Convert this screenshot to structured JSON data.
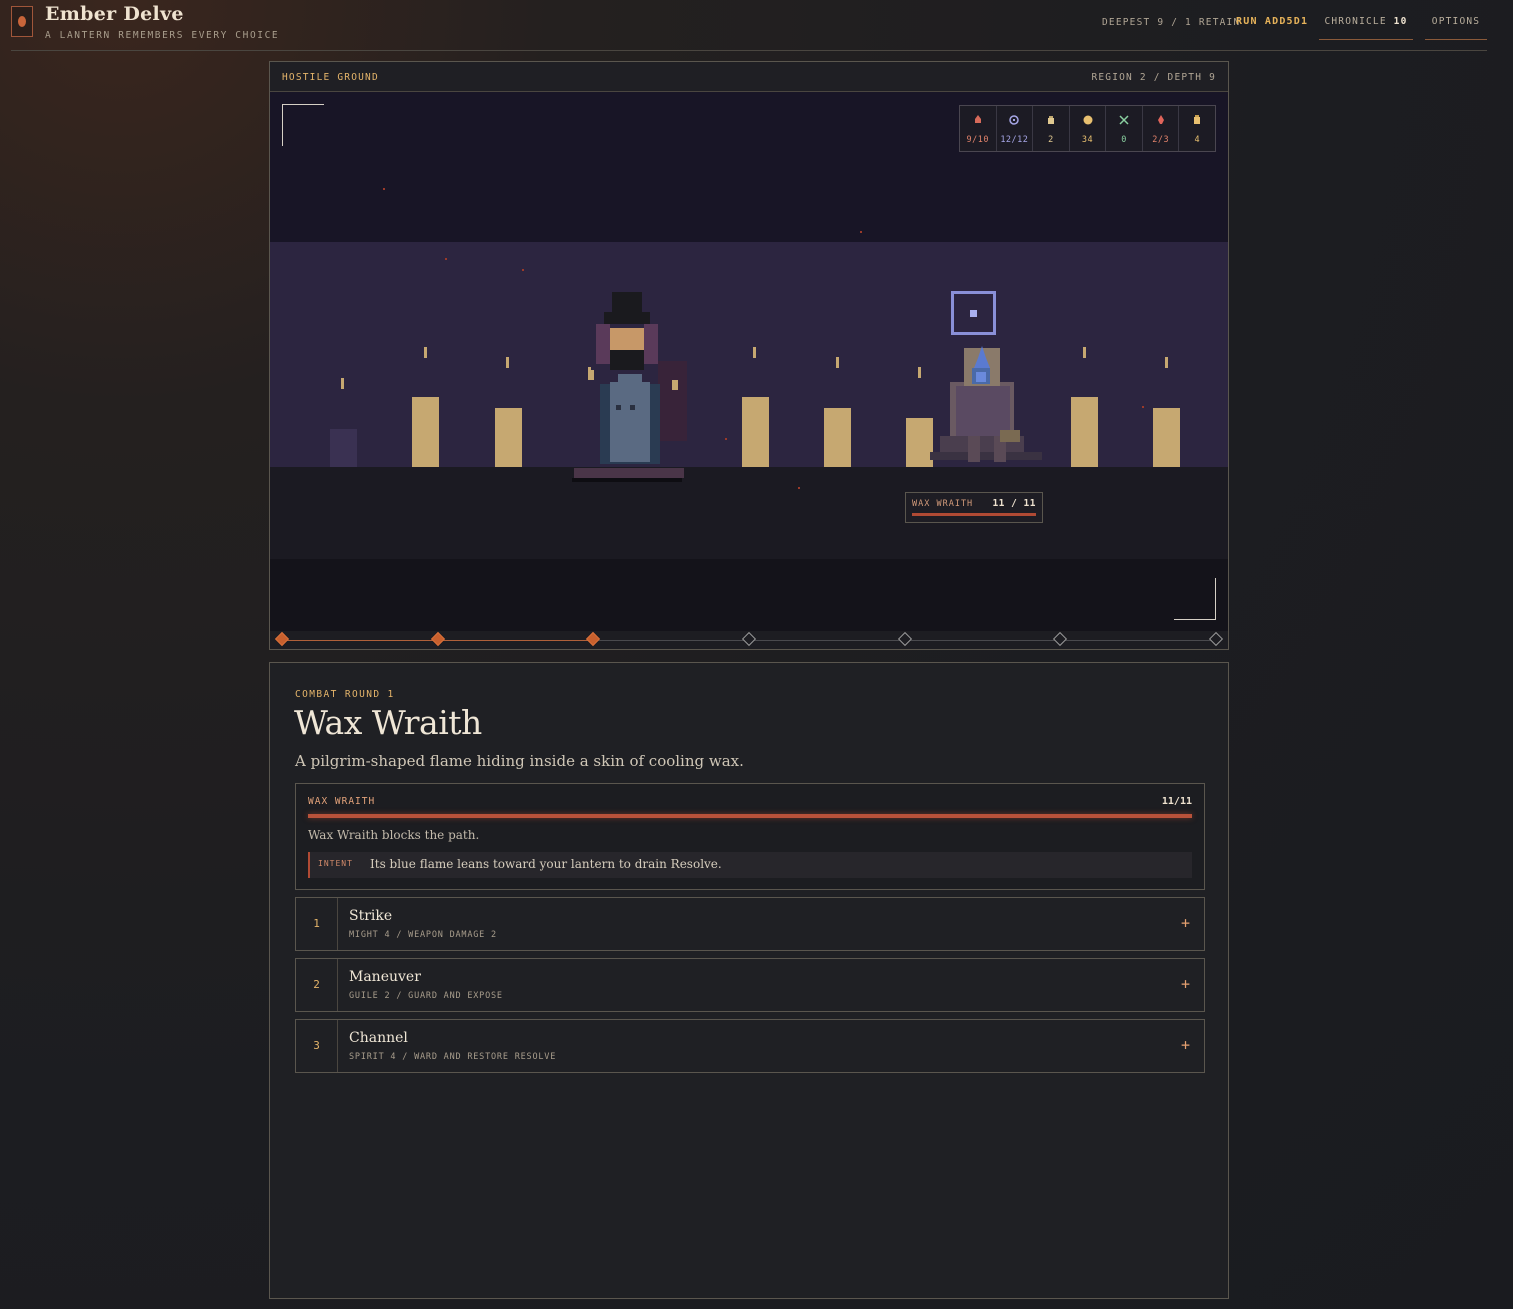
{
  "header": {
    "title": "Ember Delve",
    "subtitle": "A LANTERN REMEMBERS EVERY CHOICE",
    "deepest": "DEEPEST 9 / 1 RETAIN",
    "run": "RUN ADD5D1",
    "chronicle_label": "CHRONICLE",
    "chronicle_value": "10",
    "options_label": "OPTIONS"
  },
  "scene": {
    "tag": "HOSTILE GROUND",
    "location": "REGION 2 / DEPTH 9",
    "stats": [
      {
        "icon": "heart-flame-icon",
        "value": "9/10",
        "color": "#e0826a"
      },
      {
        "icon": "spirit-icon",
        "value": "12/12",
        "color": "#a6a6e6"
      },
      {
        "icon": "pouch-icon",
        "value": "2",
        "color": "#e0c890"
      },
      {
        "icon": "coin-icon",
        "value": "34",
        "color": "#e8c070"
      },
      {
        "icon": "crossed-swords-icon",
        "value": "0",
        "color": "#8ad0a0"
      },
      {
        "icon": "ember-icon",
        "value": "2/3",
        "color": "#e0826a"
      },
      {
        "icon": "supply-icon",
        "value": "4",
        "color": "#e8c070"
      }
    ],
    "enemy_tag": {
      "name": "WAX WRAITH",
      "hp": "11 / 11"
    },
    "progress": {
      "total_nodes": 7,
      "completed_nodes": 3
    }
  },
  "encounter": {
    "round": "COMBAT ROUND 1",
    "title": "Wax Wraith",
    "description": "A pilgrim-shaped flame hiding inside a skin of cooling wax.",
    "enemy": {
      "name": "WAX WRAITH",
      "hp": "11/11",
      "hp_fraction": 1.0,
      "status": "Wax Wraith blocks the path.",
      "intent_label": "INTENT",
      "intent_text": "Its blue flame leans toward your lantern to drain Resolve."
    },
    "actions": [
      {
        "num": "1",
        "name": "Strike",
        "detail": "MIGHT 4 / WEAPON DAMAGE 2"
      },
      {
        "num": "2",
        "name": "Maneuver",
        "detail": "GUILE 2 / GUARD AND EXPOSE"
      },
      {
        "num": "3",
        "name": "Channel",
        "detail": "SPIRIT 4 / WARD AND RESTORE RESOLVE"
      }
    ]
  }
}
